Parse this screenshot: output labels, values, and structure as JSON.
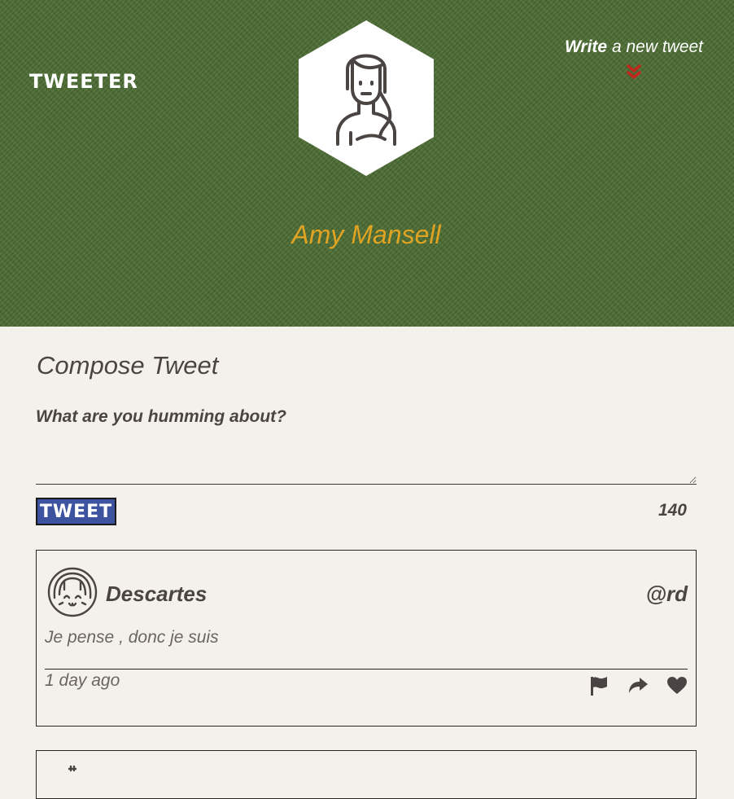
{
  "header": {
    "brand": "TWEETER",
    "write_bold": "Write",
    "write_rest": " a new tweet",
    "username": "Amy Mansell",
    "avatar_icon": "user-avatar-icon",
    "chevron_icon": "chevron-double-down-icon",
    "colors": {
      "background": "#4b6b32",
      "username": "#e0a322",
      "chevron": "#c0281e"
    }
  },
  "compose": {
    "title": "Compose Tweet",
    "placeholder": "What are you humming about?",
    "button_label": "TWEET",
    "counter": "140",
    "colors": {
      "button": "#3d53a0"
    }
  },
  "tweets": [
    {
      "name": "Descartes",
      "handle": "@rd",
      "text": "Je pense , donc je suis",
      "time": "1 day ago",
      "avatar_icon": "user-avatar-icon",
      "actions": [
        "flag-icon",
        "retweet-icon",
        "heart-icon"
      ]
    }
  ]
}
